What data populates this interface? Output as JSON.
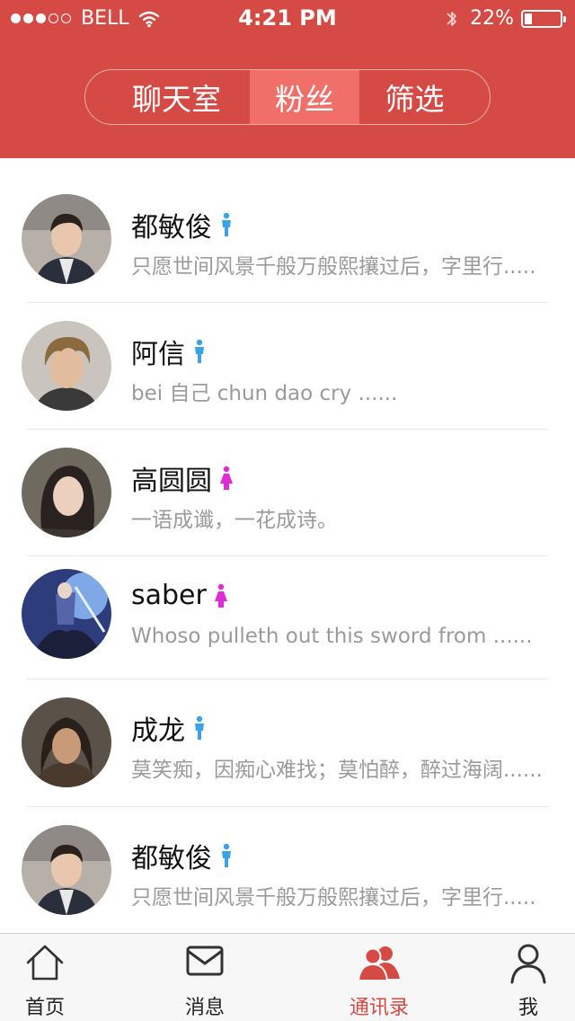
{
  "status_bar": {
    "carrier": "BELL",
    "time": "4:21 PM",
    "battery": "22%",
    "battery_level": 0.22,
    "signal_bars_filled": 3,
    "signal_bars_total": 5
  },
  "segments": [
    {
      "label": "聊天室",
      "selected": false
    },
    {
      "label": "粉丝",
      "selected": true
    },
    {
      "label": "筛选",
      "selected": false
    }
  ],
  "colors": {
    "header": "#d64a45",
    "segment_selected": "#f06f68",
    "male": "#3aa3e8",
    "female": "#e22bd8",
    "tab_active": "#d64a45"
  },
  "contacts": [
    {
      "name": "都敏俊",
      "gender": "male",
      "desc": "只愿世间风景千般万般熙攘过后，字里行....."
    },
    {
      "name": "阿信",
      "gender": "male",
      "desc": "bei 自己 chun dao  cry ......"
    },
    {
      "name": "高圆圆",
      "gender": "female",
      "desc": "一语成谶，一花成诗。"
    },
    {
      "name": "saber",
      "gender": "female",
      "desc": "Whoso pulleth out this sword from ......"
    },
    {
      "name": "成龙",
      "gender": "male",
      "desc": "莫笑痴，因痴心难找；莫怕醉，醉过海阔......"
    },
    {
      "name": "都敏俊",
      "gender": "male",
      "desc": "只愿世间风景千般万般熙攘过后，字里行....."
    }
  ],
  "tabbar": {
    "home": "首页",
    "messages": "消息",
    "contacts": "通讯录",
    "me": "我",
    "active": "contacts"
  }
}
